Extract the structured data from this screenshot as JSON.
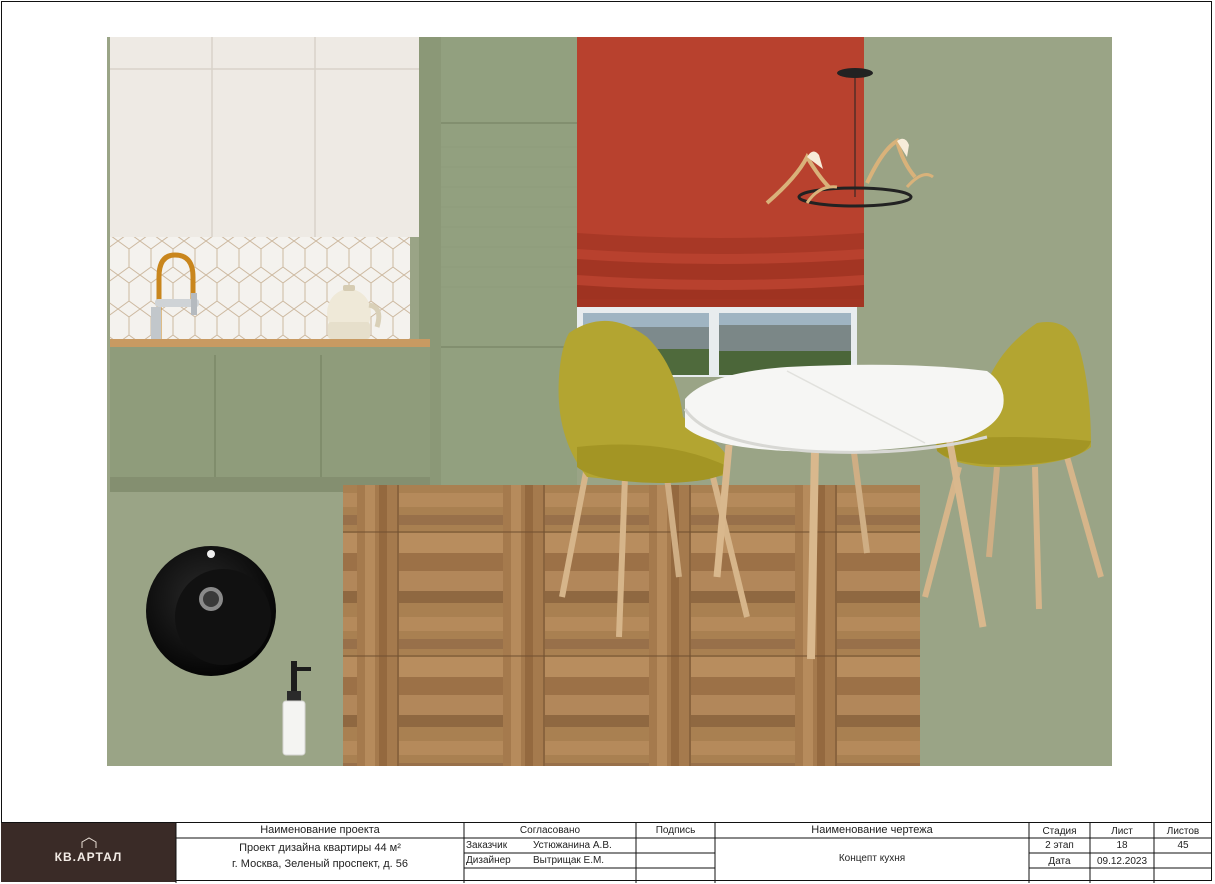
{
  "titleblock": {
    "logo_text": "КВ.АРТАЛ",
    "project_header": "Наименование проекта",
    "project_line1": "Проект дизайна квартиры 44 м²",
    "project_line2": "г. Москва, Зеленый проспект, д. 56",
    "agreed_header": "Согласовано",
    "signature_header": "Подпись",
    "client_role": "Заказчик",
    "client_name": "Устюжанина А.В.",
    "designer_role": "Дизайнер",
    "designer_name": "Вытрищак Е.М.",
    "drawing_header": "Наименование чертежа",
    "drawing_name": "Концепт кухня",
    "stage_header": "Стадия",
    "stage_value": "2 этап",
    "sheet_header": "Лист",
    "sheet_value": "18",
    "sheets_header": "Листов",
    "sheets_value": "45",
    "date_label": "Дата",
    "date_value": "09.12.2023"
  },
  "colors": {
    "wall_green": "#9aa486",
    "cabinet_green": "#8d9a79",
    "blind_red": "#b8412e",
    "chair_mustard": "#b3a531",
    "oak": "#a67b4e",
    "logo_bg": "#3a2b27"
  },
  "icons": {
    "logo": "house-logo-icon",
    "sink": "round-sink-icon",
    "soap_dispenser": "soap-dispenser-icon",
    "faucet": "faucet-icon",
    "kettle": "kettle-icon",
    "chandelier": "chandelier-icon"
  }
}
